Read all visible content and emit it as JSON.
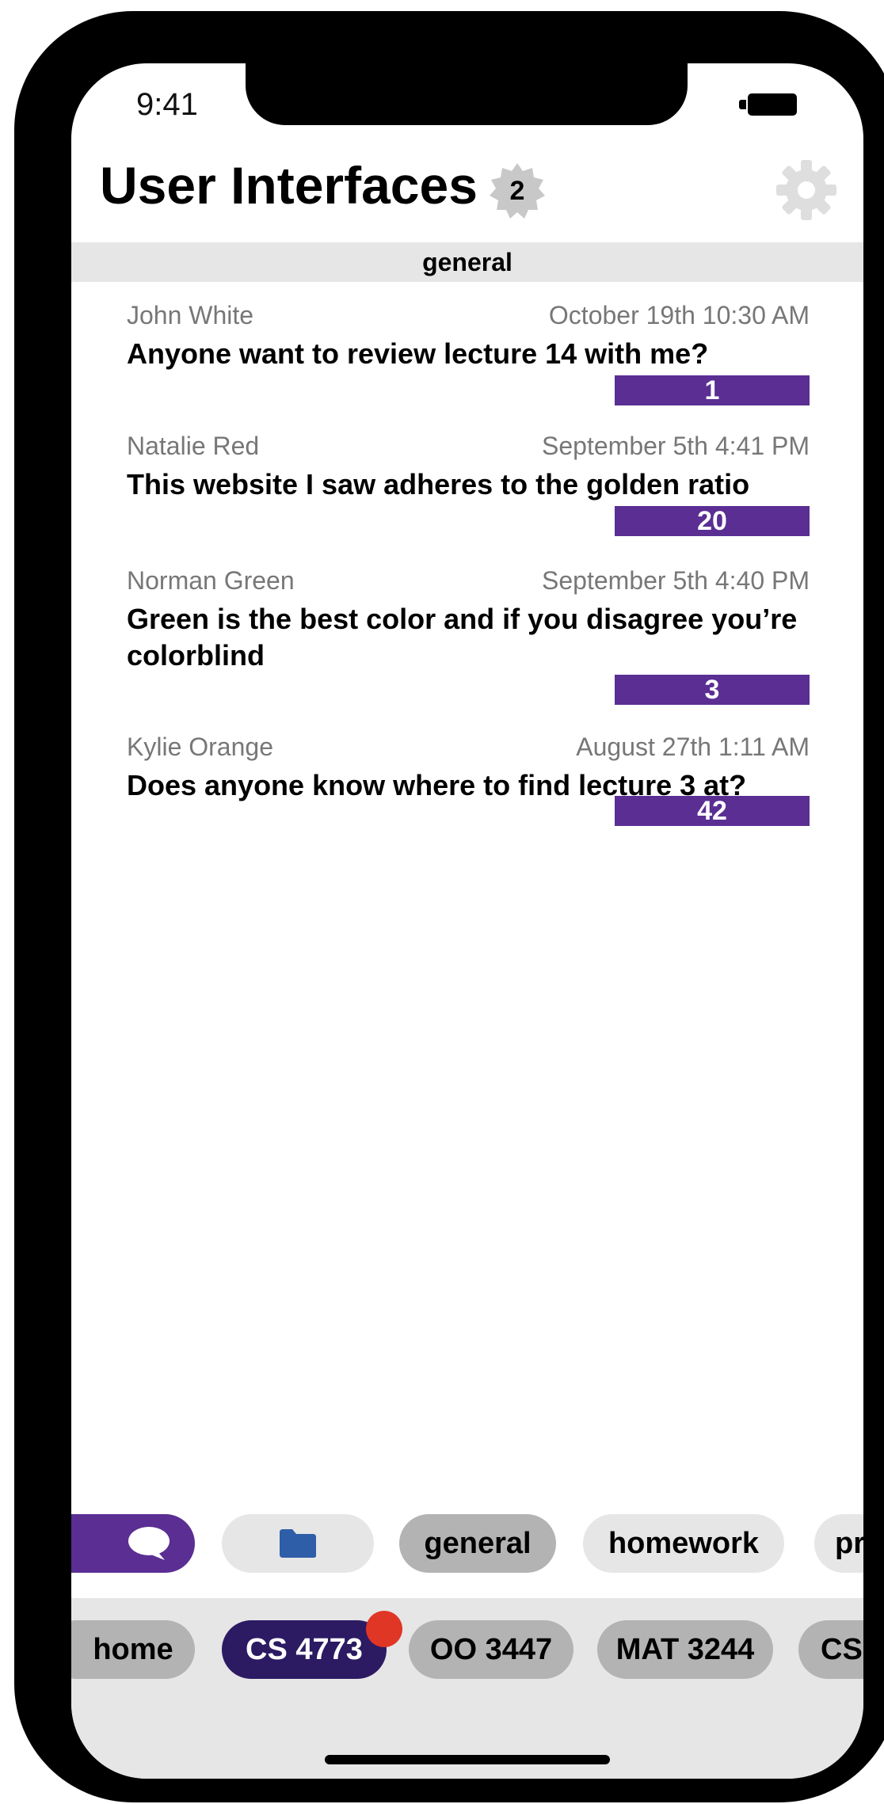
{
  "status": {
    "time": "9:41"
  },
  "header": {
    "title": "User Interfaces",
    "badge_count": "2"
  },
  "channel": {
    "name": "general"
  },
  "posts": [
    {
      "author": "John White",
      "date": "October 19th 10:30 AM",
      "text": "Anyone want to review lecture 14 with me?",
      "count": "1"
    },
    {
      "author": "Natalie Red",
      "date": "September 5th 4:41 PM",
      "text": "This website I saw adheres to the golden ratio",
      "count": "20"
    },
    {
      "author": "Norman Green",
      "date": "September 5th 4:40 PM",
      "text": "Green is the best color and if you disagree you’re colorblind",
      "count": "3"
    },
    {
      "author": "Kylie Orange",
      "date": "August 27th 1:11 AM",
      "text": "Does anyone know where to find lecture 3 at?",
      "count": "42"
    }
  ],
  "channel_tabs": {
    "icons": [
      "chat-icon",
      "folder-icon"
    ],
    "labels": [
      "general",
      "homework",
      "pr"
    ]
  },
  "course_tabs": [
    "home",
    "CS 4773",
    "OO 3447",
    "MAT 3244",
    "CS"
  ],
  "colors": {
    "accent": "#5a2e93",
    "active_course": "#2c1a63",
    "notification": "#e03626",
    "folder": "#2f5ea8"
  }
}
